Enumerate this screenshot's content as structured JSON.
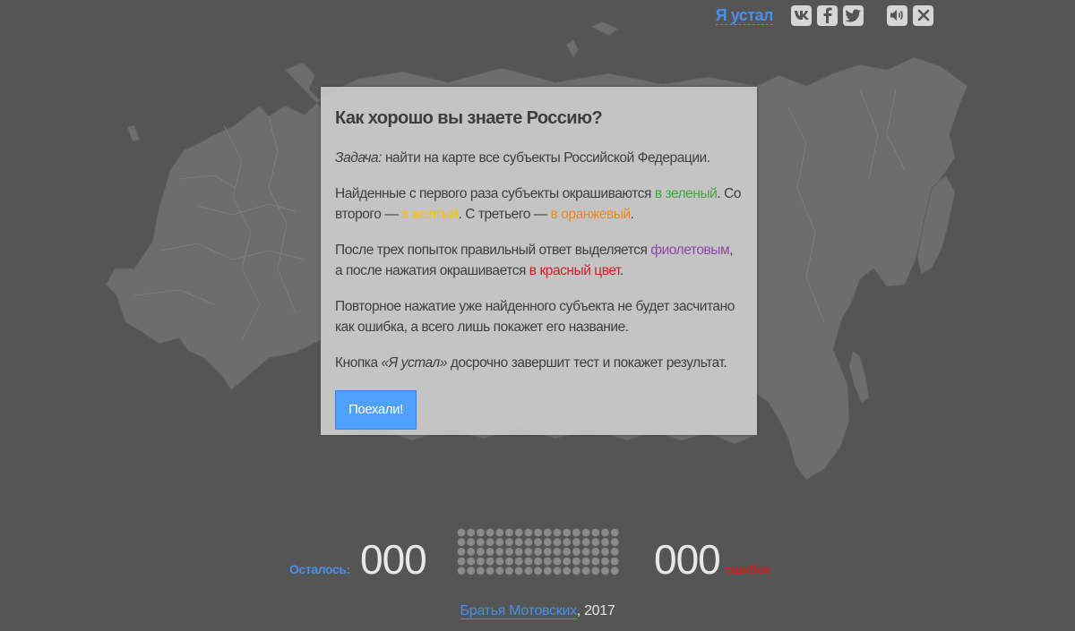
{
  "header": {
    "tired_link": "Я устал",
    "icons": [
      "vk-icon",
      "facebook-icon",
      "twitter-icon",
      "sound-icon",
      "close-icon"
    ]
  },
  "modal": {
    "title": "Как хорошо вы знаете Россию?",
    "p1": {
      "em": "Задача:",
      "text": " найти на карте все субъекты Российской Федерации."
    },
    "p2": {
      "t1": "Найденные с первого раза субъекты окрашиваются ",
      "green": "в зеленый",
      "t2": ". Со второго — ",
      "yellow": "в желтый",
      "t3": ". С третьего — ",
      "orange": "в оранжевый",
      "t4": "."
    },
    "p3": {
      "t1": "После трех попыток правильный ответ выделяется ",
      "purple": "фиолетовым",
      "t2": ", а после нажатия окрашивается ",
      "red": "в красный цвет",
      "t3": "."
    },
    "p4": "Повторное нажатие уже найденного субъекта не будет засчитано как ошибка, а всего лишь покажет его название.",
    "p5": {
      "t1": "Кнопка ",
      "em": "«Я устал»",
      "t2": " досрочно завершит тест и покажет результат."
    },
    "button": "Поехали!"
  },
  "counter": {
    "remaining_label": "Осталось:",
    "remaining_value": "000",
    "errors_value": "000",
    "errors_label": "ошибок"
  },
  "footer": {
    "author": "Братья Мотовских",
    "year": ", 2017"
  },
  "colors": {
    "background": "#555555",
    "map": "#6f6f6f",
    "accent_blue": "#4a8fe7",
    "button": "#4fa0ff",
    "green": "#3ea83e",
    "yellow": "#f6c400",
    "orange": "#ee8a1f",
    "purple": "#8e44ad",
    "red": "#d21f1f"
  }
}
